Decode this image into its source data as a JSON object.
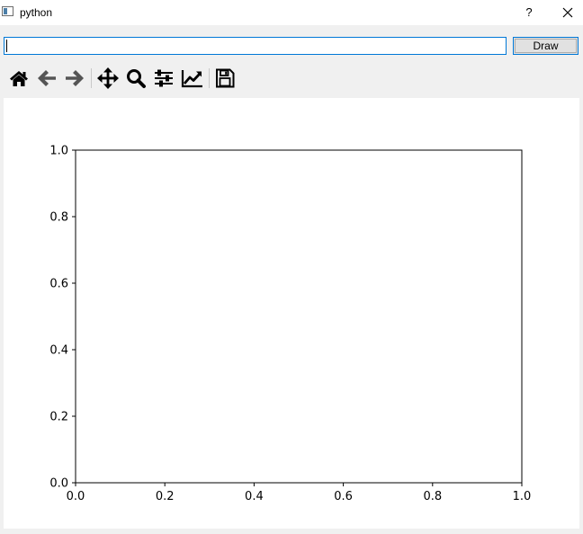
{
  "window": {
    "title": "python",
    "help_label": "?",
    "close_icon": "close-icon"
  },
  "input": {
    "value": "",
    "placeholder": ""
  },
  "draw_button": {
    "label": "Draw"
  },
  "toolbar": {
    "tools": [
      {
        "name": "home",
        "icon": "home-icon"
      },
      {
        "name": "back",
        "icon": "arrow-left-icon"
      },
      {
        "name": "forward",
        "icon": "arrow-right-icon"
      },
      {
        "name": "pan",
        "icon": "move-icon"
      },
      {
        "name": "zoom",
        "icon": "zoom-icon"
      },
      {
        "name": "subplots",
        "icon": "sliders-icon"
      },
      {
        "name": "axes",
        "icon": "line-chart-icon"
      },
      {
        "name": "save",
        "icon": "save-icon"
      }
    ]
  },
  "chart_data": {
    "type": "line",
    "series": [],
    "xlim": [
      0.0,
      1.0
    ],
    "ylim": [
      0.0,
      1.0
    ],
    "xticks": [
      "0.0",
      "0.2",
      "0.4",
      "0.6",
      "0.8",
      "1.0"
    ],
    "yticks": [
      "0.0",
      "0.2",
      "0.4",
      "0.6",
      "0.8",
      "1.0"
    ],
    "title": "",
    "xlabel": "",
    "ylabel": "",
    "grid": false
  }
}
